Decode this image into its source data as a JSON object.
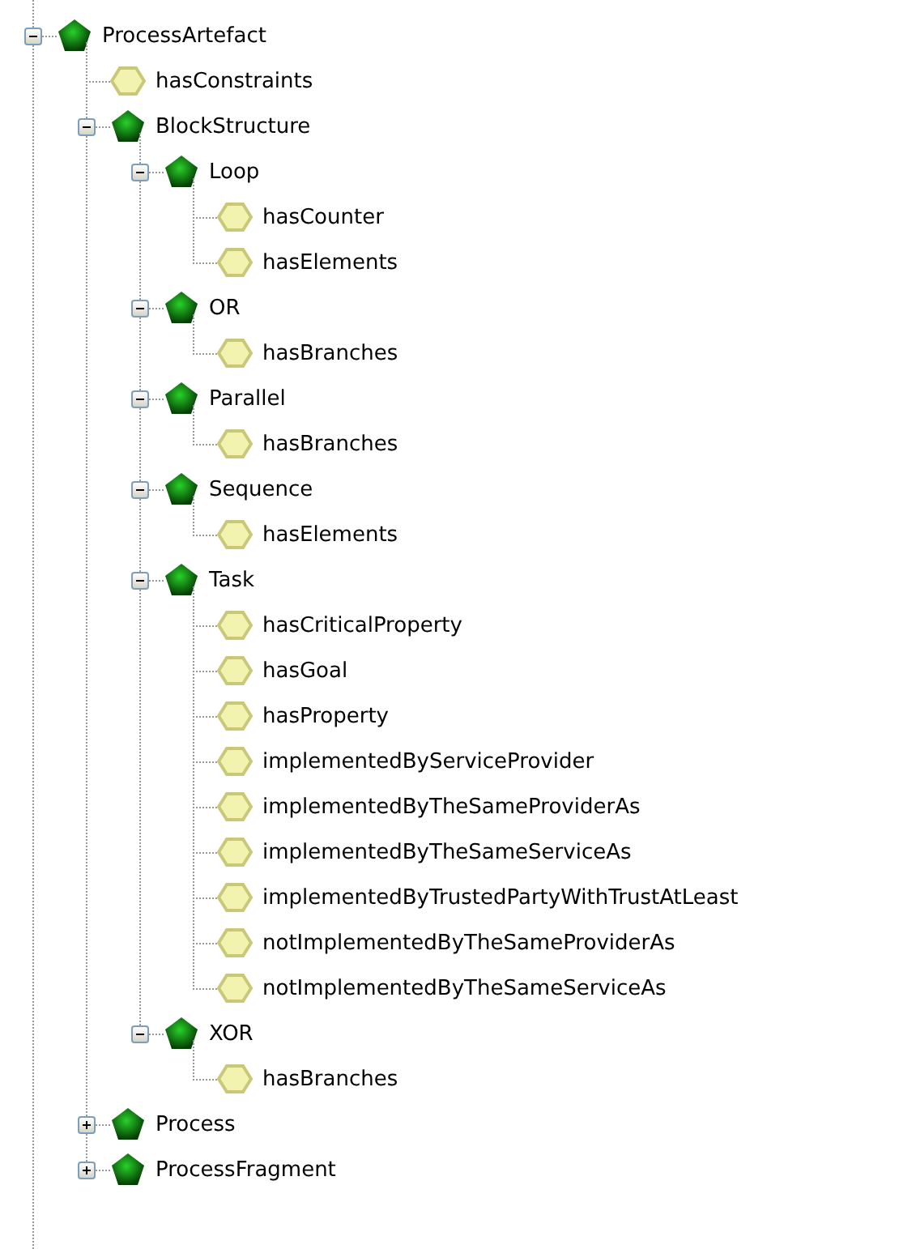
{
  "tree": [
    {
      "label": "ProcessArtefact",
      "kind": "class",
      "expanded": true,
      "children": [
        {
          "label": "hasConstraints",
          "kind": "property"
        },
        {
          "label": "BlockStructure",
          "kind": "class",
          "expanded": true,
          "children": [
            {
              "label": "Loop",
              "kind": "class",
              "expanded": true,
              "children": [
                {
                  "label": "hasCounter",
                  "kind": "property"
                },
                {
                  "label": "hasElements",
                  "kind": "property"
                }
              ]
            },
            {
              "label": "OR",
              "kind": "class",
              "expanded": true,
              "children": [
                {
                  "label": "hasBranches",
                  "kind": "property"
                }
              ]
            },
            {
              "label": "Parallel",
              "kind": "class",
              "expanded": true,
              "children": [
                {
                  "label": "hasBranches",
                  "kind": "property"
                }
              ]
            },
            {
              "label": "Sequence",
              "kind": "class",
              "expanded": true,
              "children": [
                {
                  "label": "hasElements",
                  "kind": "property"
                }
              ]
            },
            {
              "label": "Task",
              "kind": "class",
              "expanded": true,
              "children": [
                {
                  "label": "hasCriticalProperty",
                  "kind": "property"
                },
                {
                  "label": "hasGoal",
                  "kind": "property"
                },
                {
                  "label": "hasProperty",
                  "kind": "property"
                },
                {
                  "label": "implementedByServiceProvider",
                  "kind": "property"
                },
                {
                  "label": "implementedByTheSameProviderAs",
                  "kind": "property"
                },
                {
                  "label": "implementedByTheSameServiceAs",
                  "kind": "property"
                },
                {
                  "label": "implementedByTrustedPartyWithTrustAtLeast",
                  "kind": "property"
                },
                {
                  "label": "notImplementedByTheSameProviderAs",
                  "kind": "property"
                },
                {
                  "label": "notImplementedByTheSameServiceAs",
                  "kind": "property"
                }
              ]
            },
            {
              "label": "XOR",
              "kind": "class",
              "expanded": true,
              "children": [
                {
                  "label": "hasBranches",
                  "kind": "property"
                }
              ]
            }
          ]
        },
        {
          "label": "Process",
          "kind": "class",
          "expanded": false
        },
        {
          "label": "ProcessFragment",
          "kind": "class",
          "expanded": false
        }
      ]
    }
  ]
}
